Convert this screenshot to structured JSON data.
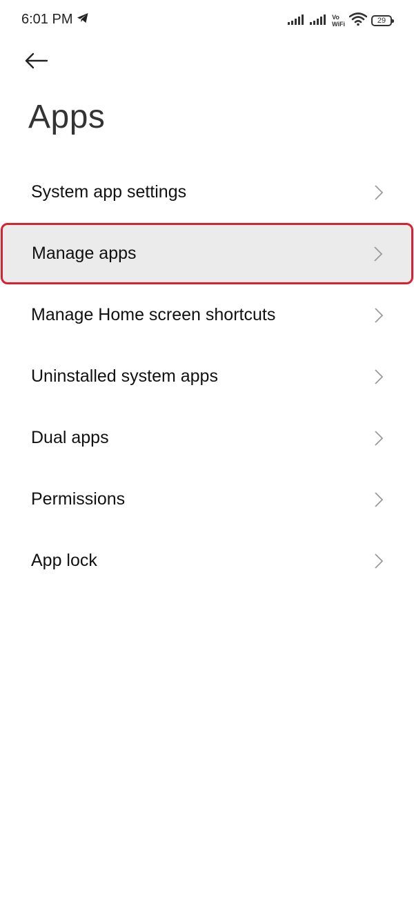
{
  "status_bar": {
    "time": "6:01 PM",
    "vowifi_top": "Vo",
    "vowifi_bottom": "WiFi",
    "battery": "29",
    "icons": [
      "telegram-icon",
      "signal-icon",
      "signal-icon",
      "wifi-icon",
      "battery-icon"
    ]
  },
  "header": {
    "back_icon": "back-arrow-icon",
    "title": "Apps"
  },
  "menu": {
    "items": [
      {
        "label": "System app settings"
      },
      {
        "label": "Manage apps"
      },
      {
        "label": "Manage Home screen shortcuts"
      },
      {
        "label": "Uninstalled system apps"
      },
      {
        "label": "Dual apps"
      },
      {
        "label": "Permissions"
      },
      {
        "label": "App lock"
      }
    ]
  },
  "colors": {
    "highlight_border": "#d9202e",
    "highlight_background": "#ebebeb",
    "chevron": "#9a9a9a"
  }
}
